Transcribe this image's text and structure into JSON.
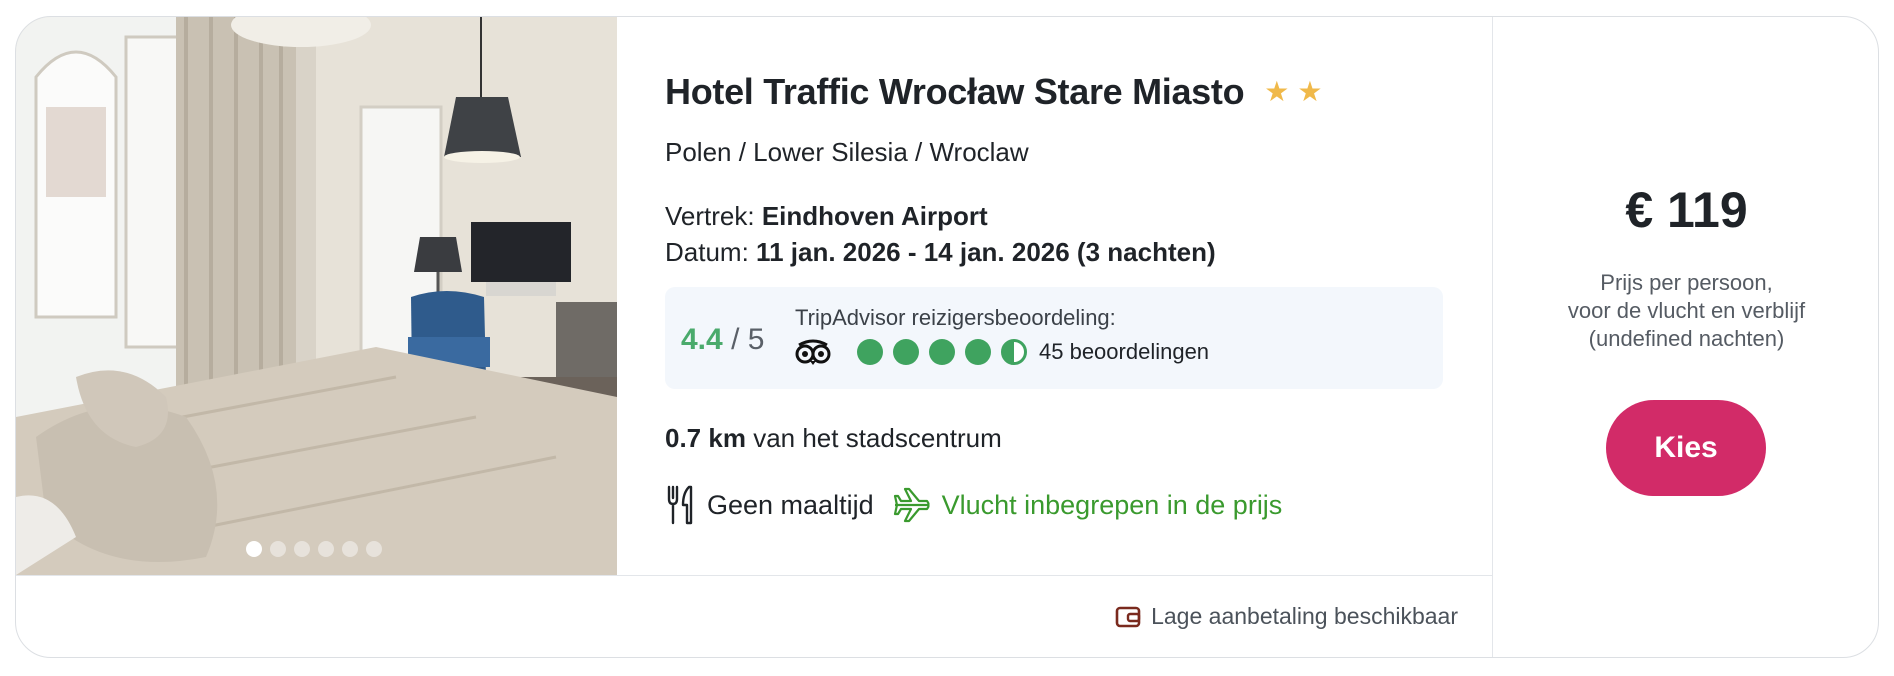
{
  "hotel": {
    "name": "Hotel Traffic Wrocław Stare Miasto",
    "stars": 2,
    "location": "Polen / Lower Silesia / Wroclaw"
  },
  "trip": {
    "departure_label": "Vertrek:",
    "departure_value": "Eindhoven Airport",
    "date_label": "Datum:",
    "date_value": "11 jan. 2026 - 14 jan. 2026 (3 nachten)"
  },
  "rating": {
    "score": "4.4",
    "of": "/ 5",
    "label": "TripAdvisor reizigersbeoordeling:",
    "bubbles": 4.5,
    "reviews": "45 beoordelingen",
    "color": "#3fa35f"
  },
  "distance": {
    "value": "0.7 km",
    "suffix": "van het stadscentrum"
  },
  "features": {
    "meal": "Geen maaltijd",
    "flight": "Vlucht inbegrepen in de prijs",
    "meal_icon": "fork-knife-icon",
    "flight_icon": "plane-icon"
  },
  "footer": {
    "deposit": "Lage aanbetaling beschikbaar",
    "deposit_icon": "wallet-icon"
  },
  "price": {
    "amount": "€ 119",
    "note_line1": "Prijs per persoon,",
    "note_line2": "voor de vlucht en verblijf",
    "note_line3": "(undefined nachten)"
  },
  "cta": {
    "label": "Kies",
    "color": "#d22b68"
  },
  "gallery": {
    "slides": 6,
    "active_slide": 1
  }
}
